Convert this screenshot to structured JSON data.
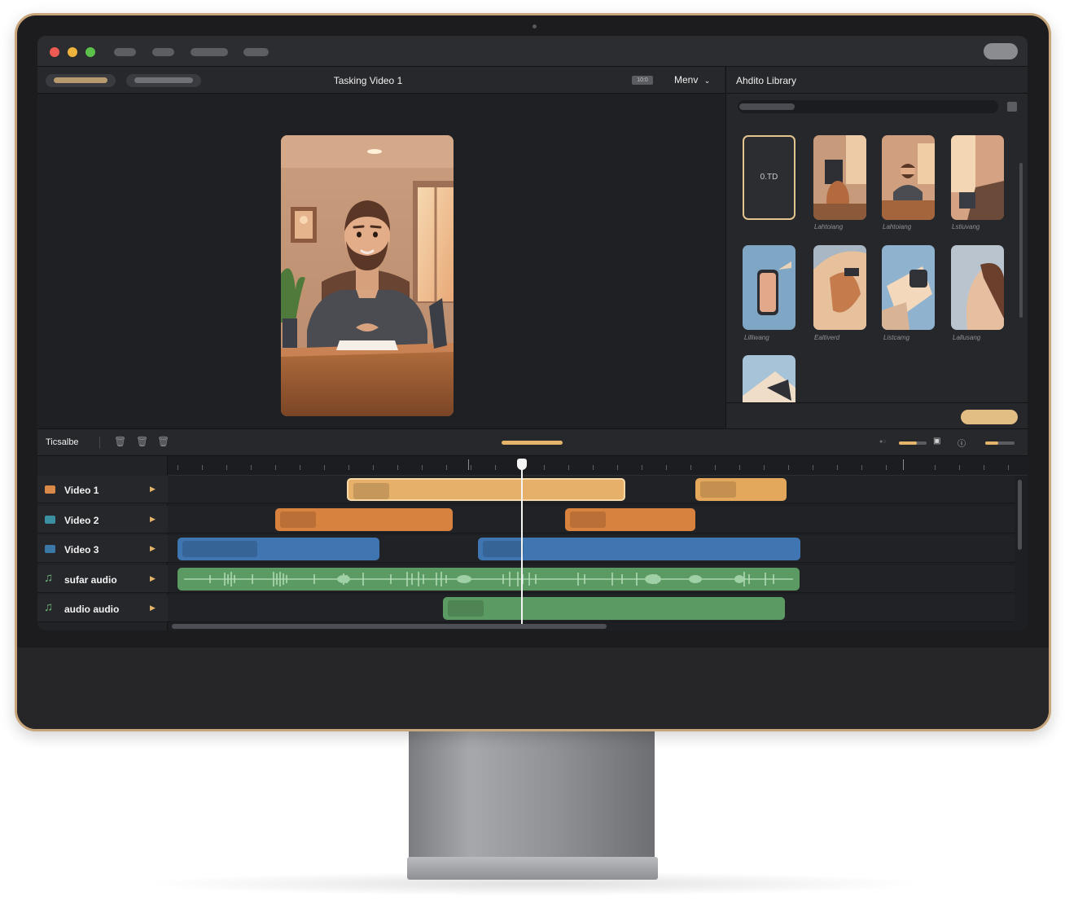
{
  "window": {
    "title": "Tasking Video 1",
    "menu_label": "Menv",
    "timecode_badge": "10:0"
  },
  "viewer": {
    "transport_icons": [
      "skip-back-icon",
      "step-back-icon",
      "play-icon",
      "step-forward-icon",
      "skip-forward-icon"
    ],
    "left_controls": [
      "snap-icon",
      "transform-icon",
      "chevron-down-icon"
    ]
  },
  "library": {
    "title": "Ahdito Library",
    "selected_label": "0.TD",
    "captions": [
      "Lahtoiang",
      "Lahtoiang",
      "Lstiuvang",
      "Lilliwang",
      "Ealtiverd",
      "Listcamg",
      "Lallusang"
    ]
  },
  "timeline": {
    "title": "Ticsalbe",
    "tracks": [
      {
        "name": "Video 1",
        "kind": "video",
        "color": "#d98a48"
      },
      {
        "name": "Video 2",
        "kind": "video",
        "color": "#3b8fa0"
      },
      {
        "name": "Video 3",
        "kind": "video",
        "color": "#3b78a6"
      },
      {
        "name": "sufar audio",
        "kind": "audio",
        "color": "#6fb37a"
      },
      {
        "name": "audio audio",
        "kind": "audio",
        "color": "#6fb37a"
      }
    ]
  },
  "colors": {
    "accent": "#e4b46a",
    "video1_clip": "#e6b06b",
    "video2_clip": "#d8823f",
    "video3_clip": "#3f75b0",
    "audio_clip": "#5c9a63"
  }
}
